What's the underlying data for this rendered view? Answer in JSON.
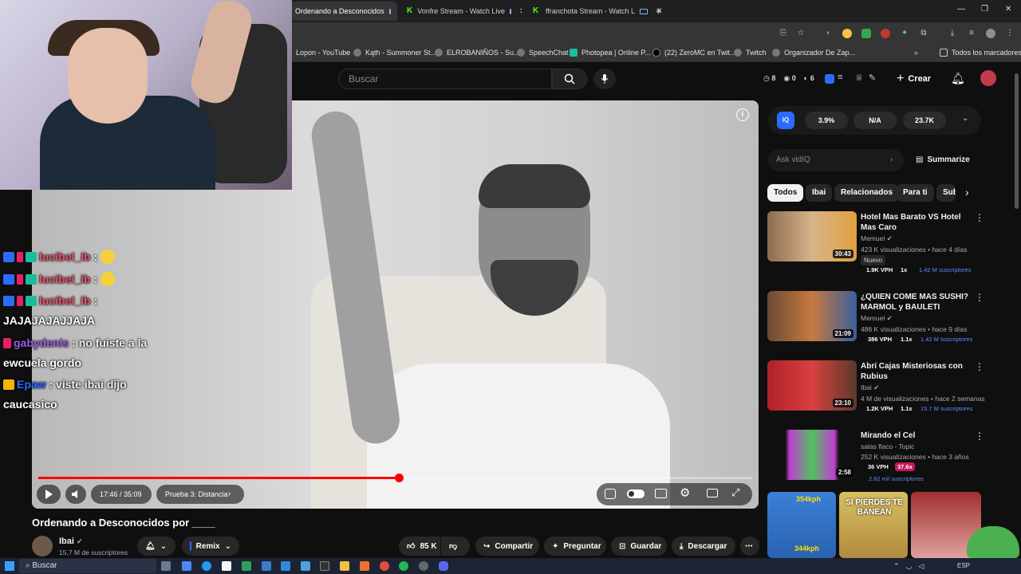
{
  "browser": {
    "tabs": [
      {
        "label": "Ordenando a Desconocidos"
      },
      {
        "label": "Vonfre Stream - Watch Live"
      },
      {
        "label": "ffranchota Stream - Watch L"
      }
    ],
    "new_tab": "+",
    "bookmarks": [
      "Lopon - YouTube",
      "Kąth - Summoner St...",
      "ELROBANIÑOS - Su...",
      "SpeechChat",
      "Photopea | Online P...",
      "(22) ZeroMC en Twit...",
      "Twitch",
      "Organizador De Zap..."
    ],
    "all_bookmarks": "Todos los marcadores"
  },
  "youtube": {
    "search_placeholder": "Buscar",
    "create_label": "Crear",
    "header_stats": [
      "8",
      "0",
      "6"
    ]
  },
  "player": {
    "time": "17:46 / 35:09",
    "chapter": "Prueba 3: Distancia",
    "progress_fraction": 0.505
  },
  "chat": [
    {
      "user": "lucibel_ib",
      "sep": " :",
      "text": "",
      "user_color": "#e8516f"
    },
    {
      "user": "lucibel_ib",
      "sep": " :",
      "text": "",
      "user_color": "#e8516f"
    },
    {
      "user": "lucibel_ib",
      "sep": " :",
      "text": "",
      "user_color": "#e8516f"
    },
    {
      "user": "",
      "sep": "",
      "text": "JAJAJAJAJJAJA",
      "user_color": "#ffffff"
    },
    {
      "user": "gabydenis",
      "sep": " : ",
      "text": "no fuiste a la",
      "user_color": "#9b5de5"
    },
    {
      "user": "",
      "sep": "",
      "text": "ewcuela gordo",
      "user_color": "#ffffff"
    },
    {
      "user": "Epaw",
      "sep": " : ",
      "text": "viste ibai dijo",
      "user_color": "#2b6cff"
    },
    {
      "user": "",
      "sep": "",
      "text": "caucasico",
      "user_color": "#ffffff"
    }
  ],
  "video": {
    "title": "Ordenando a Desconocidos por ____",
    "channel": "Ibai",
    "subscribers": "15,7 M de suscriptores",
    "remix": "Remix",
    "likes": "85 K",
    "share": "Compartir",
    "ask": "Preguntar",
    "save": "Guardar",
    "download": "Descargar"
  },
  "vidiq": {
    "stats": [
      "3.9%",
      "N/A",
      "23.7K"
    ],
    "ask_placeholder": "Ask vidIQ",
    "summarize": "Summarize"
  },
  "chips": [
    "Todos",
    "Ibai",
    "Relacionados",
    "Para ti",
    "Sub"
  ],
  "recommended": [
    {
      "title": "Hotel Mas Barato VS Hotel Mas Caro",
      "channel": "Memuel",
      "meta": "423 K visualizaciones • hace 4 días",
      "badge": "Nuevo",
      "duration": "30:43",
      "vph": "1.9K VPH",
      "ratio": "1x",
      "subs": "1.42 M suscriptores"
    },
    {
      "title": "¿QUIEN COME MAS SUSHI? MARMOL y BAULETI",
      "channel": "Memuel",
      "meta": "486 K visualizaciones • hace 9 días",
      "badge": "",
      "duration": "21:09",
      "vph": "386 VPH",
      "ratio": "1.1x",
      "subs": "1.42 M suscriptores"
    },
    {
      "title": "Abrí Cajas Misteriosas con Rubius",
      "channel": "Ibai",
      "meta": "4 M de visualizaciones • hace 2 semanas",
      "badge": "",
      "duration": "23:10",
      "vph": "1.2K VPH",
      "ratio": "1.1x",
      "subs": "15.7 M suscriptores"
    },
    {
      "title": "Mirando el Cel",
      "channel": "salas flaco - Topic",
      "meta": "252 K visualizaciones • hace 3 años",
      "badge": "",
      "duration": "2:58",
      "vph": "36 VPH",
      "ratio": "37.6x",
      "subs": "2.82 mil suscriptores"
    }
  ],
  "shorts": [
    "354kph",
    "SI PIERDES TE BANEAN",
    "344kph"
  ],
  "taskbar": {
    "search": "Buscar",
    "lang": "ESP"
  }
}
